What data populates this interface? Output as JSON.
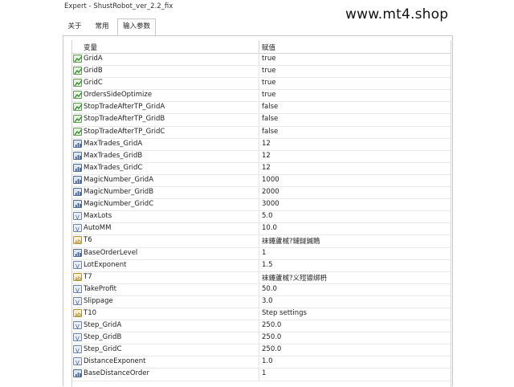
{
  "window": {
    "title": "Expert - ShustRobot_ver_2.2_fix"
  },
  "watermark": "www.mt4.shop",
  "tabs": [
    {
      "label": "关于"
    },
    {
      "label": "常用"
    },
    {
      "label": "输入参数"
    }
  ],
  "table": {
    "headers": {
      "variable": "变量",
      "value": "赋值"
    },
    "rows": [
      {
        "type": "bool",
        "name": "GridA",
        "value": "true"
      },
      {
        "type": "bool",
        "name": "GridB",
        "value": "true"
      },
      {
        "type": "bool",
        "name": "GridC",
        "value": "true"
      },
      {
        "type": "bool",
        "name": "OrdersSideOptimize",
        "value": "true"
      },
      {
        "type": "bool",
        "name": "StopTradeAfterTP_GridA",
        "value": "false"
      },
      {
        "type": "bool",
        "name": "StopTradeAfterTP_GridB",
        "value": "false"
      },
      {
        "type": "bool",
        "name": "StopTradeAfterTP_GridC",
        "value": "false"
      },
      {
        "type": "int",
        "name": "MaxTrades_GridA",
        "value": "12"
      },
      {
        "type": "int",
        "name": "MaxTrades_GridB",
        "value": "12"
      },
      {
        "type": "int",
        "name": "MaxTrades_GridC",
        "value": "12"
      },
      {
        "type": "int",
        "name": "MagicNumber_GridA",
        "value": "1000"
      },
      {
        "type": "int",
        "name": "MagicNumber_GridB",
        "value": "2000"
      },
      {
        "type": "int",
        "name": "MagicNumber_GridC",
        "value": "3000"
      },
      {
        "type": "dbl",
        "name": "MaxLots",
        "value": "5.0"
      },
      {
        "type": "dbl",
        "name": "AutoMM",
        "value": "10.0"
      },
      {
        "type": "str",
        "name": "T6",
        "value": "袜鑳蘆棫?鏈鐩鍼瞗"
      },
      {
        "type": "int",
        "name": "BaseOrderLevel",
        "value": "1"
      },
      {
        "type": "dbl",
        "name": "LotExponent",
        "value": "1.5"
      },
      {
        "type": "str",
        "name": "T7",
        "value": "袜鑳蘆棫?义殌镲绑枬"
      },
      {
        "type": "dbl",
        "name": "TakeProfit",
        "value": "50.0"
      },
      {
        "type": "dbl",
        "name": "Slippage",
        "value": "3.0"
      },
      {
        "type": "str",
        "name": "T10",
        "value": "Step settings"
      },
      {
        "type": "dbl",
        "name": "Step_GridA",
        "value": "250.0"
      },
      {
        "type": "dbl",
        "name": "Step_GridB",
        "value": "250.0"
      },
      {
        "type": "dbl",
        "name": "Step_GridC",
        "value": "250.0"
      },
      {
        "type": "dbl",
        "name": "DistanceExponent",
        "value": "1.0"
      },
      {
        "type": "int",
        "name": "BaseDistanceOrder",
        "value": "1"
      }
    ]
  },
  "icons": {
    "bool": "bool-param-icon",
    "int": "int-param-icon",
    "dbl": "double-param-icon",
    "str": "string-param-icon"
  }
}
